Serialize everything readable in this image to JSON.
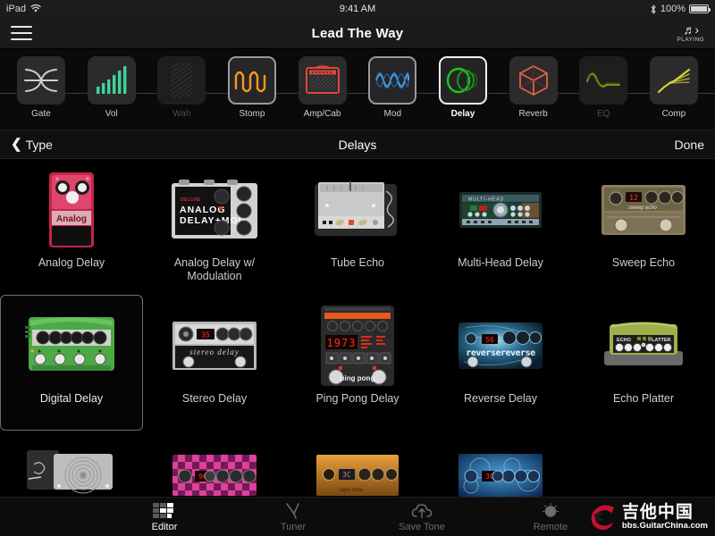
{
  "statusbar": {
    "device": "iPad",
    "wifi_icon": "wifi-icon",
    "time": "9:41 AM",
    "bluetooth_icon": "bluetooth-icon",
    "battery_percent": "100%"
  },
  "titlebar": {
    "menu_icon": "hamburger-menu-icon",
    "song_title": "Lead The Way",
    "playing_icon": "music-note-icon",
    "playing_label": "PLAYING"
  },
  "signal_chain": {
    "items": [
      {
        "label": "Gate",
        "icon": "noise-gate-icon",
        "state": "on"
      },
      {
        "label": "Vol",
        "icon": "volume-bars-icon",
        "state": "on"
      },
      {
        "label": "Wah",
        "icon": "wah-icon",
        "state": "off"
      },
      {
        "label": "Stomp",
        "icon": "stomp-wave-icon",
        "state": "selected-soft"
      },
      {
        "label": "Amp/Cab",
        "icon": "amp-cabinet-icon",
        "state": "on"
      },
      {
        "label": "Mod",
        "icon": "modulation-icon",
        "state": "selected-soft"
      },
      {
        "label": "Delay",
        "icon": "delay-circles-icon",
        "state": "selected"
      },
      {
        "label": "Reverb",
        "icon": "reverb-cube-icon",
        "state": "on"
      },
      {
        "label": "EQ",
        "icon": "eq-curve-icon",
        "state": "off"
      },
      {
        "label": "Comp",
        "icon": "compressor-icon",
        "state": "on"
      }
    ]
  },
  "navbar": {
    "back_chevron": "chevron-left-icon",
    "back_label": "Type",
    "title": "Delays",
    "done_label": "Done"
  },
  "grid": {
    "rows": [
      [
        {
          "label": "Analog Delay",
          "art": "analog-delay",
          "selected": false
        },
        {
          "label": "Analog Delay w/ Modulation",
          "art": "analog-delay-mod",
          "selected": false
        },
        {
          "label": "Tube Echo",
          "art": "tube-echo",
          "selected": false
        },
        {
          "label": "Multi-Head Delay",
          "art": "multi-head-delay",
          "selected": false
        },
        {
          "label": "Sweep Echo",
          "art": "sweep-echo",
          "selected": false
        }
      ],
      [
        {
          "label": "Digital Delay",
          "art": "digital-delay",
          "selected": true
        },
        {
          "label": "Stereo Delay",
          "art": "stereo-delay",
          "selected": false
        },
        {
          "label": "Ping Pong Delay",
          "art": "ping-pong-delay",
          "selected": false
        },
        {
          "label": "Reverse Delay",
          "art": "reverse-delay",
          "selected": false
        },
        {
          "label": "Echo Platter",
          "art": "echo-platter",
          "selected": false
        }
      ],
      [
        {
          "label": "",
          "art": "tape-echo-partial",
          "selected": false
        },
        {
          "label": "",
          "art": "pink-checker-partial",
          "selected": false
        },
        {
          "label": "",
          "art": "orange-delay-partial",
          "selected": false
        },
        {
          "label": "",
          "art": "blue-delay-partial",
          "selected": false
        },
        {
          "label": "",
          "art": "empty-partial",
          "selected": false
        }
      ]
    ]
  },
  "pedal_text": {
    "analog_delay_name": "Analog",
    "analog_mod_deluxe": "DELUXE",
    "analog_mod_line1": "ANALOG",
    "analog_mod_line2": "DELAY+MOD",
    "multi_head_name": "MULTI-HEAD",
    "sweep_echo_name": "sweep echo",
    "sweep_echo_display": "12",
    "stereo_delay_name": "stereo delay",
    "stereo_delay_display": "35",
    "ping_pong_name": "ping pong",
    "ping_pong_display": "1973",
    "reverse_delay_name": "reversereverse",
    "reverse_delay_display": "56",
    "echo_platter_left": "ECHO",
    "echo_platter_right": "PLATTER",
    "pink_display": "9C",
    "orange_display": "3C",
    "blue_display": "3C"
  },
  "tabbar": {
    "tabs": [
      {
        "label": "Editor",
        "icon": "editor-grid-icon",
        "active": true
      },
      {
        "label": "Tuner",
        "icon": "tuning-fork-icon",
        "active": false
      },
      {
        "label": "Save Tone",
        "icon": "cloud-upload-icon",
        "active": false
      },
      {
        "label": "Remote",
        "icon": "remote-knob-icon",
        "active": false
      }
    ]
  },
  "watermark": {
    "logo_icon": "guitarchina-logo-icon",
    "chinese": "吉他中国",
    "url": "bbs.GuitarChina.com"
  },
  "colors": {
    "accent_green": "#22c322",
    "accent_orange": "#f59a1e",
    "accent_red": "#ff2d16",
    "bg": "#000000",
    "chrome": "#1b1b1b"
  }
}
